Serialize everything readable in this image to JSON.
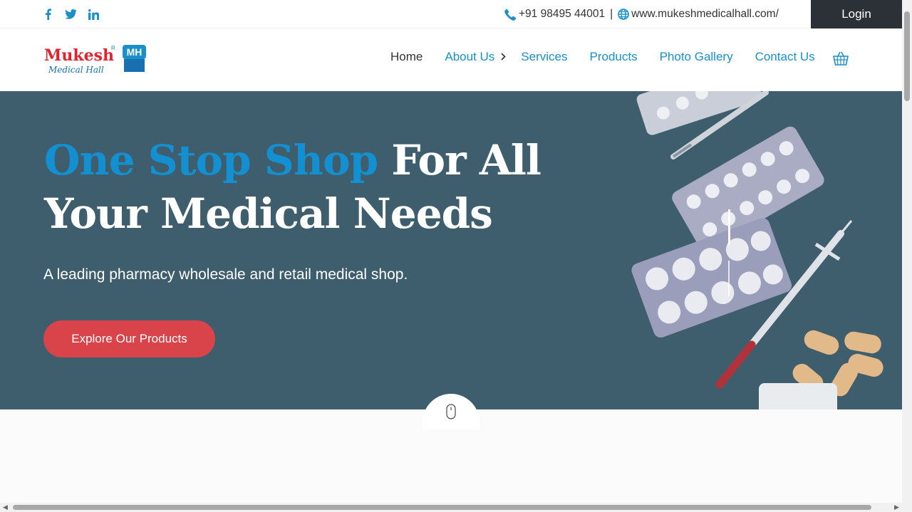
{
  "topbar": {
    "social": [
      "facebook-icon",
      "twitter-icon",
      "linkedin-icon"
    ],
    "phone": "+91 98495 44001",
    "separator": "|",
    "website": "www.mukeshmedicalhall.com/",
    "login_label": "Login"
  },
  "header": {
    "logo_text": "Mukesh",
    "logo_subtext": "Medical Hall",
    "logo_mark": "MH",
    "logo_reg": "R",
    "nav": {
      "home": "Home",
      "about": "About Us",
      "services": "Services",
      "products": "Products",
      "gallery": "Photo Gallery",
      "contact": "Contact Us"
    }
  },
  "hero": {
    "headline_blue": "One Stop Shop",
    "headline_white": "For All Your Medical Needs",
    "tagline": "A leading pharmacy wholesale and retail medical shop.",
    "cta_label": "Explore Our Products"
  },
  "colors": {
    "accent_blue": "#1390d1",
    "cta_red": "#d9434a",
    "hero_bg": "#3f5e6d",
    "login_bg": "#2b3137"
  }
}
